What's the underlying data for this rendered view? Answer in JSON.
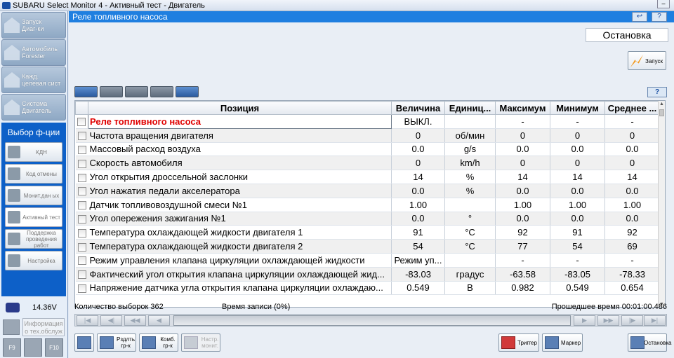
{
  "window": {
    "title": "SUBARU Select Monitor 4 - Активный тест - Двигатель",
    "min_label": "–"
  },
  "sidebar": {
    "nav": [
      {
        "label_1": "Запуск",
        "label_2": "Диаг-ки"
      },
      {
        "label_1": "Автомобиль",
        "label_2": "Forester"
      },
      {
        "label_1": "Кажд.",
        "label_2": "целевая сист"
      },
      {
        "label_1": "Система",
        "label_2": "Двигатель"
      }
    ],
    "function_header": "Выбор ф-ции",
    "functions": [
      {
        "label": "КДН"
      },
      {
        "label": "Код отмены"
      },
      {
        "label": "Монит.дан ых"
      },
      {
        "label": "Активный тест"
      },
      {
        "label": "Поддержка проведения работ"
      },
      {
        "label": "Настройка"
      }
    ],
    "voltage": "14.36V",
    "info_button": "Информация о тех.обслуж",
    "bottom_icons": [
      "F9",
      "",
      "F10"
    ]
  },
  "main": {
    "header_title": "Реле топливного насоса",
    "header_buttons": [
      "↩",
      "?"
    ],
    "status": "Остановка",
    "start_button": "Запуск",
    "help": "?",
    "table": {
      "headers": [
        "Позиция",
        "Величина",
        "Единиц...",
        "Максимум",
        "Минимум",
        "Среднее ..."
      ],
      "rows": [
        {
          "name": "Реле топливного насоса",
          "value": "ВЫКЛ.",
          "unit": "",
          "max": "-",
          "min": "-",
          "avg": "-"
        },
        {
          "name": "Частота вращения двигателя",
          "value": "0",
          "unit": "об/мин",
          "max": "0",
          "min": "0",
          "avg": "0"
        },
        {
          "name": "Массовый расход воздуха",
          "value": "0.0",
          "unit": "g/s",
          "max": "0.0",
          "min": "0.0",
          "avg": "0.0"
        },
        {
          "name": "Скорость автомобиля",
          "value": "0",
          "unit": "km/h",
          "max": "0",
          "min": "0",
          "avg": "0"
        },
        {
          "name": "Угол открытия дроссельной заслонки",
          "value": "14",
          "unit": "%",
          "max": "14",
          "min": "14",
          "avg": "14"
        },
        {
          "name": "Угол нажатия педали акселератора",
          "value": "0.0",
          "unit": "%",
          "max": "0.0",
          "min": "0.0",
          "avg": "0.0"
        },
        {
          "name": "Датчик топливовоздушной смеси №1",
          "value": "1.00",
          "unit": "",
          "max": "1.00",
          "min": "1.00",
          "avg": "1.00"
        },
        {
          "name": "Угол опережения зажигания №1",
          "value": "0.0",
          "unit": "°",
          "max": "0.0",
          "min": "0.0",
          "avg": "0.0"
        },
        {
          "name": "Температура охлаждающей жидкости двигателя 1",
          "value": "91",
          "unit": "°C",
          "max": "92",
          "min": "91",
          "avg": "92"
        },
        {
          "name": "Температура охлаждающей жидкости двигателя 2",
          "value": "54",
          "unit": "°C",
          "max": "77",
          "min": "54",
          "avg": "69"
        },
        {
          "name": "Режим управления клапана циркуляции охлаждающей жидкости",
          "value": "Режим уп...",
          "unit": "",
          "max": "-",
          "min": "-",
          "avg": "-"
        },
        {
          "name": "Фактический угол открытия клапана циркуляции охлаждающей жид...",
          "value": "-83.03",
          "unit": "градус",
          "max": "-63.58",
          "min": "-83.05",
          "avg": "-78.33"
        },
        {
          "name": "Напряжение датчика угла открытия клапана циркуляции охлаждаю...",
          "value": "0.549",
          "unit": "В",
          "max": "0.982",
          "min": "0.549",
          "avg": "0.654"
        }
      ]
    },
    "samples": "Количество выборок 362",
    "record_time": "Время записи (0%)",
    "elapsed": "Прошедшее время 00:01:00.486",
    "bottom_buttons": {
      "split": "Рздлть гр-к",
      "combo": "Комб. гр-к",
      "settings": "Настр. монит.",
      "trigger": "Триггер",
      "marker": "Маркер",
      "stop": "Остановка"
    }
  }
}
